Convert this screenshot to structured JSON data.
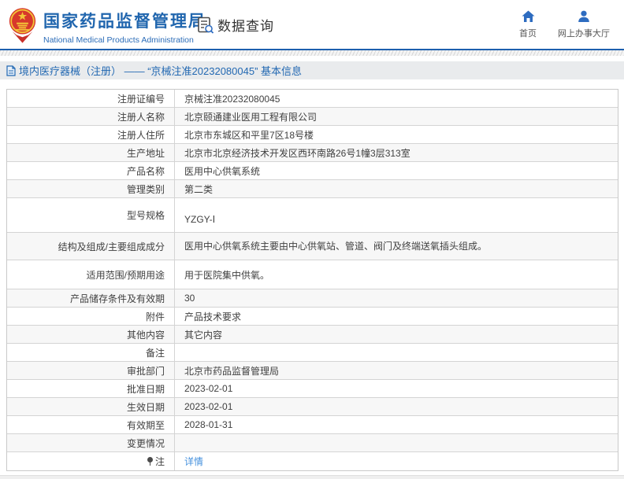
{
  "header": {
    "logo_title": "国家药品监督管理局",
    "logo_subtitle": "National Medical Products Administration",
    "data_query_label": "数据查询",
    "nav": [
      {
        "icon": "home-icon",
        "label": "首页"
      },
      {
        "icon": "person-icon",
        "label": "网上办事大厅"
      }
    ]
  },
  "breadcrumb": {
    "icon": "document-icon",
    "text": "境内医疗器械（注册） —— “京械注准20232080045” 基本信息"
  },
  "colors": {
    "brand_blue": "#2166ae",
    "icon_blue": "#2e6cc0",
    "link_blue": "#4490dd",
    "row_alt_gray": "#f7f7f7"
  },
  "table": {
    "rows": [
      {
        "label": "注册证编号",
        "value": "京械注准20232080045"
      },
      {
        "label": "注册人名称",
        "value": "北京颐通建业医用工程有限公司"
      },
      {
        "label": "注册人住所",
        "value": "北京市东城区和平里7区18号楼"
      },
      {
        "label": "生产地址",
        "value": "北京市北京经济技术开发区西环南路26号1幢3层313室"
      },
      {
        "label": "产品名称",
        "value": "医用中心供氧系统"
      },
      {
        "label": "管理类别",
        "value": "第二类"
      },
      {
        "label": "型号规格",
        "value": "YZGY-Ⅰ"
      },
      {
        "label": "结构及组成/主要组成成分",
        "value": "医用中心供氧系统主要由中心供氧站、管道、阀门及终端送氧插头组成。"
      },
      {
        "label": "适用范围/预期用途",
        "value": "用于医院集中供氧。"
      },
      {
        "label": "产品储存条件及有效期",
        "value": "30"
      },
      {
        "label": "附件",
        "value": "产品技术要求"
      },
      {
        "label": "其他内容",
        "value": "其它内容"
      },
      {
        "label": "备注",
        "value": ""
      },
      {
        "label": "审批部门",
        "value": "北京市药品监督管理局"
      },
      {
        "label": "批准日期",
        "value": "2023-02-01"
      },
      {
        "label": "生效日期",
        "value": "2023-02-01"
      },
      {
        "label": "有效期至",
        "value": "2028-01-31"
      },
      {
        "label": "变更情况",
        "value": ""
      },
      {
        "label": "注",
        "value": "详情",
        "link": true,
        "label_icon": "pin-icon"
      }
    ]
  }
}
